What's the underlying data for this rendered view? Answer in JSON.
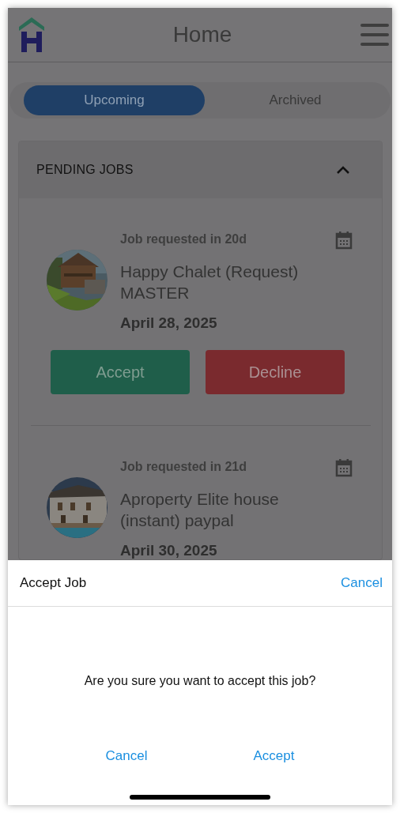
{
  "header": {
    "title": "Home"
  },
  "tabs": [
    {
      "label": "Upcoming",
      "selected": true
    },
    {
      "label": "Archived",
      "selected": false
    }
  ],
  "section": {
    "title": "PENDING JOBS",
    "expanded": true,
    "jobs": [
      {
        "requested": "Job requested in 20d",
        "title": "Happy Chalet (Request) MASTER",
        "date": "April 28, 2025",
        "actions": [
          {
            "label": "Accept",
            "kind": "accept"
          },
          {
            "label": "Decline",
            "kind": "decline"
          }
        ]
      },
      {
        "requested": "Job requested in 21d",
        "title": "Aproperty Elite house (instant) paypal",
        "date": "April 30, 2025"
      }
    ]
  },
  "dialog": {
    "title": "Accept Job",
    "close": "Cancel",
    "message": "Are you sure you want to accept this job?",
    "actions": [
      "Cancel",
      "Accept"
    ]
  }
}
